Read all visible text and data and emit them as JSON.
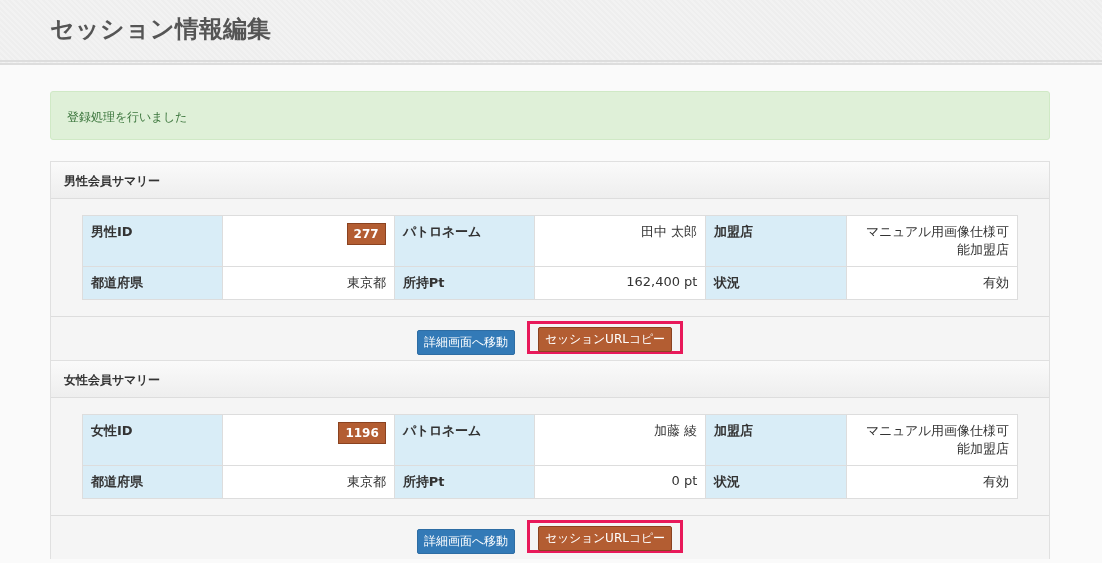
{
  "page_title": "セッション情報編集",
  "alert": "登録処理を行いました",
  "panels": [
    {
      "title": "男性会員サマリー",
      "rows": [
        [
          {
            "label": "男性ID",
            "value": "277",
            "kind": "badge"
          },
          {
            "label": "パトロネーム",
            "value": "田中 太郎",
            "kind": "text"
          },
          {
            "label": "加盟店",
            "value": "マニュアル用画像仕様可能加盟店",
            "kind": "text"
          }
        ],
        [
          {
            "label": "都道府県",
            "value": "東京都",
            "kind": "text"
          },
          {
            "label": "所持Pt",
            "value": "162,400 pt",
            "kind": "text"
          },
          {
            "label": "状況",
            "value": "有効",
            "kind": "text"
          }
        ]
      ],
      "buttons": [
        {
          "label": "詳細画面へ移動",
          "kind": "primary",
          "highlighted": false
        },
        {
          "label": "セッションURLコピー",
          "kind": "copy",
          "highlighted": true
        }
      ]
    },
    {
      "title": "女性会員サマリー",
      "rows": [
        [
          {
            "label": "女性ID",
            "value": "1196",
            "kind": "badge"
          },
          {
            "label": "パトロネーム",
            "value": "加藤 綾",
            "kind": "text"
          },
          {
            "label": "加盟店",
            "value": "マニュアル用画像仕様可能加盟店",
            "kind": "text"
          }
        ],
        [
          {
            "label": "都道府県",
            "value": "東京都",
            "kind": "text"
          },
          {
            "label": "所持Pt",
            "value": "0 pt",
            "kind": "text"
          },
          {
            "label": "状況",
            "value": "有効",
            "kind": "text"
          }
        ]
      ],
      "buttons": [
        {
          "label": "詳細画面へ移動",
          "kind": "primary",
          "highlighted": false
        },
        {
          "label": "セッションURLコピー",
          "kind": "copy",
          "highlighted": true
        }
      ]
    }
  ]
}
